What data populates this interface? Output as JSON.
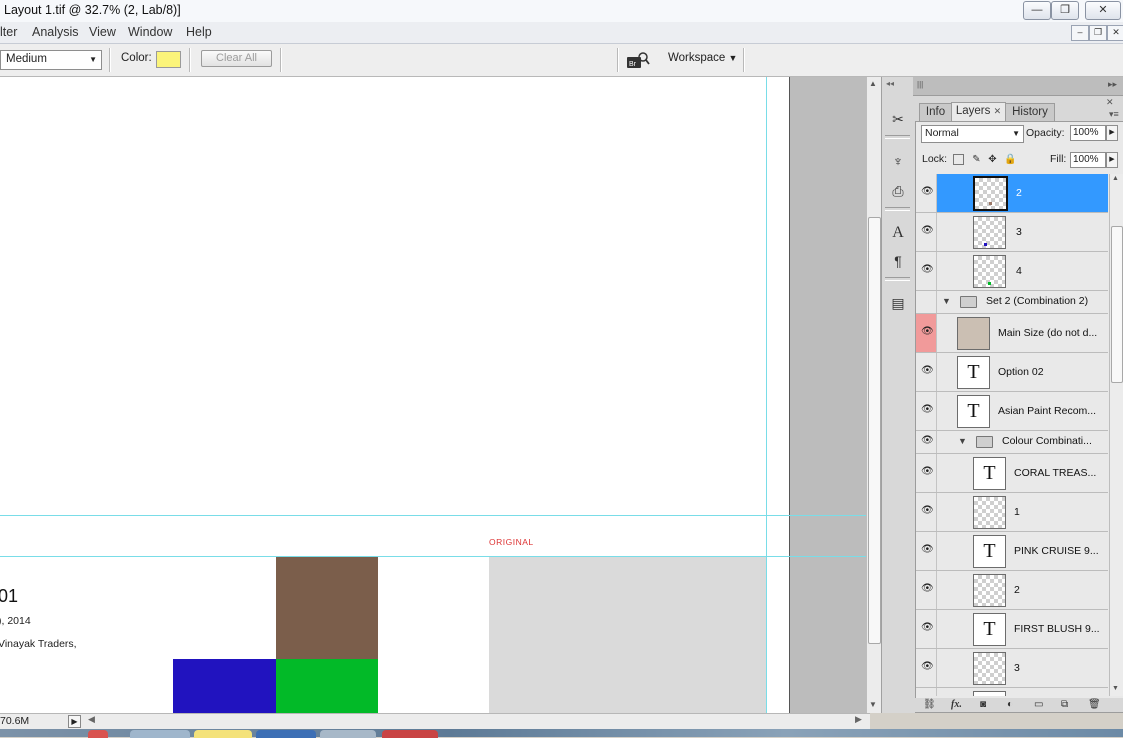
{
  "window": {
    "title": "Layout 1.tif @ 32.7% (2, Lab/8)]",
    "controls": {
      "minimize": "—",
      "restore": "❐",
      "close": "✕"
    }
  },
  "menu": {
    "items": [
      "lter",
      "Analysis",
      "View",
      "Window",
      "Help"
    ],
    "doc_controls": {
      "minimize": "–",
      "restore": "❐",
      "close": "✕"
    }
  },
  "options": {
    "size_value": "Medium",
    "color_label": "Color:",
    "color_value": "#fbf47a",
    "clear_all": "Clear All",
    "workspace": "Workspace"
  },
  "document": {
    "original_label": "ORIGINAL",
    "number_text": "01",
    "date_text": "), 2014",
    "trader_text": "Vinayak Traders,",
    "swatch_colors": {
      "brown": "#7b5e4b",
      "blue": "#2113bf",
      "green": "#02ba28"
    }
  },
  "status": {
    "doc_size": "70.6M"
  },
  "panel": {
    "tabs": [
      {
        "label": "Info",
        "active": false
      },
      {
        "label": "Layers",
        "active": true,
        "close": "✕"
      },
      {
        "label": "History",
        "active": false
      }
    ],
    "blend_mode": "Normal",
    "opacity_label": "Opacity:",
    "opacity_value": "100%",
    "lock_label": "Lock:",
    "fill_label": "Fill:",
    "fill_value": "100%",
    "layers": [
      {
        "name": "2",
        "kind": "pixel",
        "visible": true,
        "selected": true
      },
      {
        "name": "3",
        "kind": "pixel",
        "visible": true
      },
      {
        "name": "4",
        "kind": "pixel",
        "visible": true
      },
      {
        "name": "Set 2 (Combination 2)",
        "kind": "group",
        "visible": false
      },
      {
        "name": "Main Size (do not d...",
        "kind": "pixel",
        "visible": true
      },
      {
        "name": "Option 02",
        "kind": "text",
        "visible": true
      },
      {
        "name": "Asian Paint Recom...",
        "kind": "text",
        "visible": true
      },
      {
        "name": "Colour Combinati...",
        "kind": "group",
        "visible": true
      },
      {
        "name": "CORAL TREAS...",
        "kind": "text",
        "visible": true
      },
      {
        "name": "1",
        "kind": "pixel",
        "visible": true
      },
      {
        "name": "PINK CRUISE  9...",
        "kind": "text",
        "visible": true
      },
      {
        "name": "2",
        "kind": "pixel",
        "visible": true
      },
      {
        "name": "FIRST BLUSH 9...",
        "kind": "text",
        "visible": true
      },
      {
        "name": "3",
        "kind": "pixel",
        "visible": true
      }
    ],
    "footer_icons": [
      "link-icon",
      "fx-icon",
      "mask-icon",
      "adjustment-icon",
      "group-icon",
      "new-layer-icon",
      "trash-icon"
    ]
  }
}
